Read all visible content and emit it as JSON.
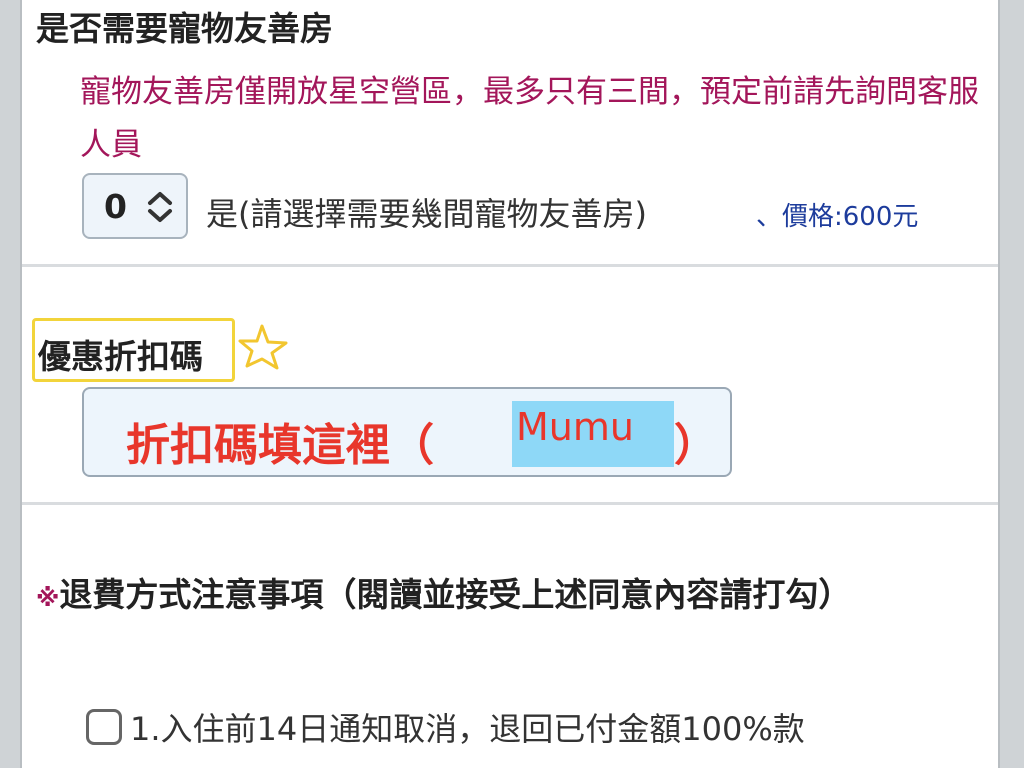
{
  "pet_room": {
    "heading": "是否需要寵物友善房",
    "note": "寵物友善房僅開放星空營區，最多只有三間，預定前請先詢問客服人員",
    "stepper_value": "0",
    "label": "是(請選擇需要幾間寵物友善房)",
    "price": "、價格:600元"
  },
  "discount": {
    "heading": "優惠折扣碼",
    "placeholder_text": "折扣碼填這裡（",
    "code": "Mumu",
    "close_paren": "）"
  },
  "refund": {
    "mark": "※",
    "title": "退費方式注意事項（閱讀並接受上述同意內容請打勾）",
    "items": [
      {
        "label": "1.入住前14日通知取消，退回已付金額100%款",
        "checked": false
      }
    ]
  },
  "colors": {
    "note": "#a3165a",
    "price": "#1d3c9c",
    "promo_text": "#e8362b",
    "code_highlight": "#8ed8f7",
    "heading_highlight": "#f2d43b"
  },
  "icons": {
    "stepper": "chevron-up-down-icon",
    "decoration": "star-doodle-icon"
  }
}
